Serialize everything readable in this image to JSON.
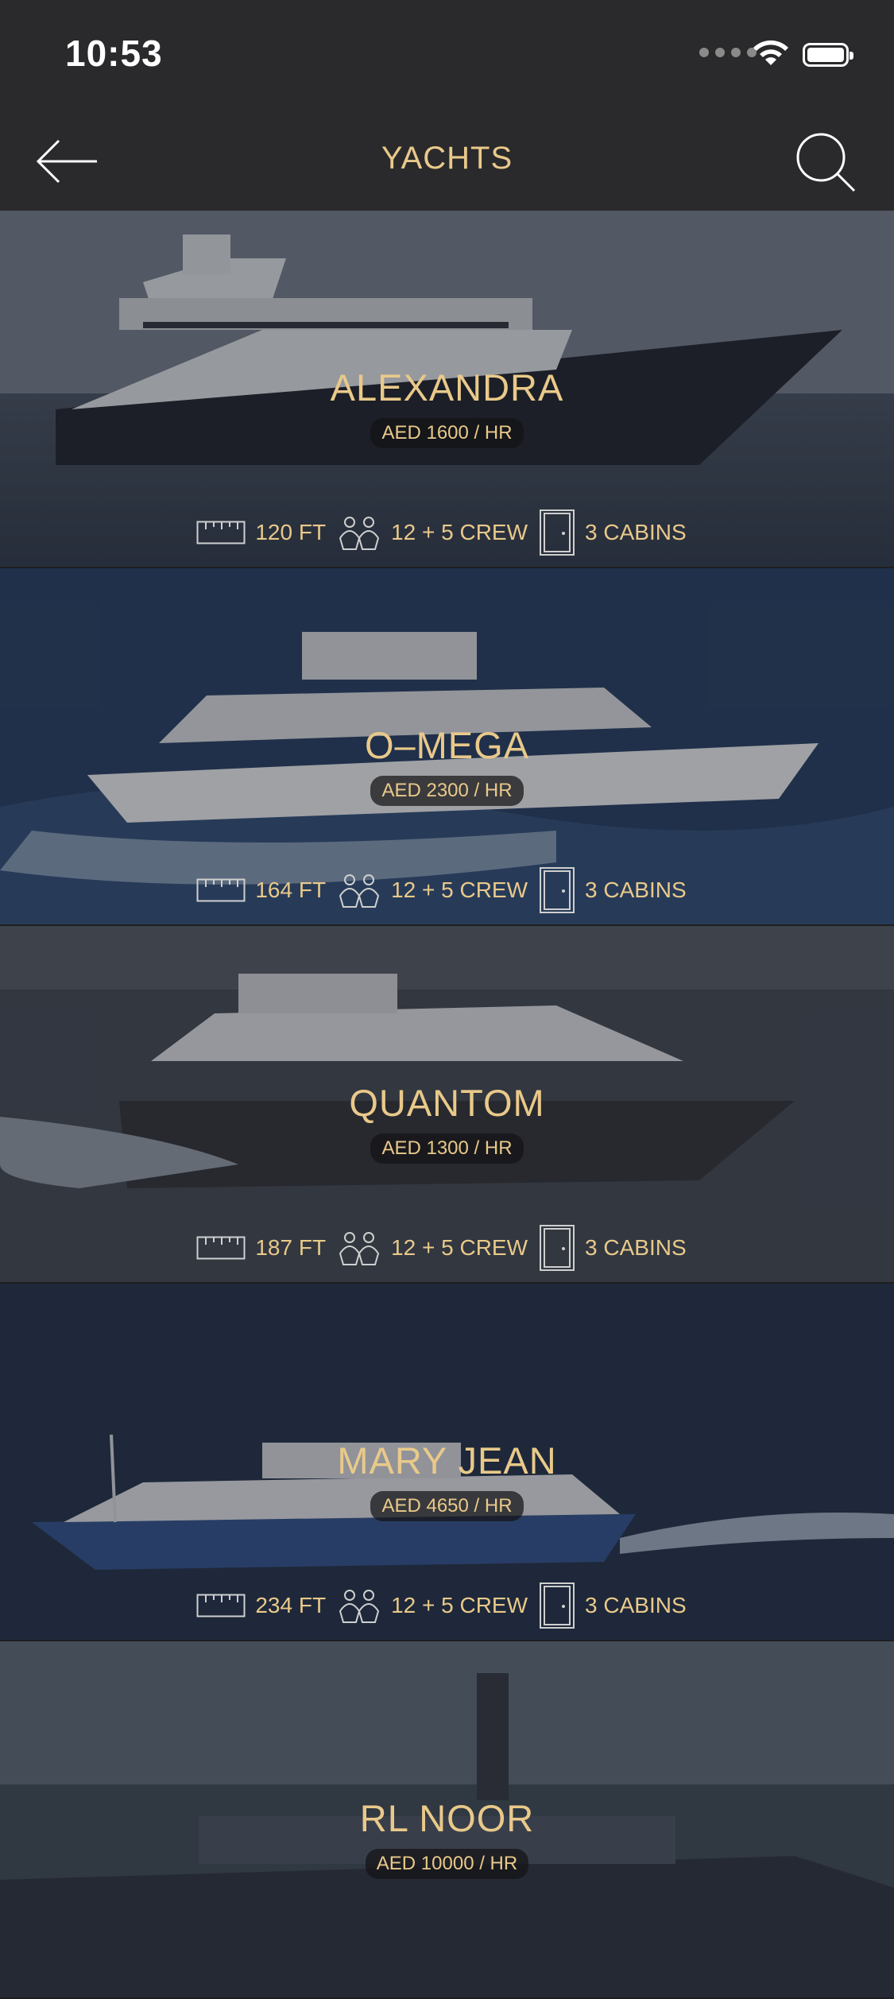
{
  "status": {
    "time": "10:53"
  },
  "nav": {
    "title": "YACHTS"
  },
  "colors": {
    "accent": "#e9c98a",
    "background": "#2a2a2c"
  },
  "yachts": [
    {
      "name": "ALEXANDRA",
      "price": "AED 1600 / HR",
      "length": "120 FT",
      "crew": "12 + 5 CREW",
      "cabins": "3 CABINS"
    },
    {
      "name": "O–MEGA",
      "price": "AED 2300 / HR",
      "length": "164 FT",
      "crew": "12 + 5 CREW",
      "cabins": "3 CABINS"
    },
    {
      "name": "QUANTOM",
      "price": "AED 1300 / HR",
      "length": "187 FT",
      "crew": "12 + 5 CREW",
      "cabins": "3 CABINS"
    },
    {
      "name": "MARY JEAN",
      "price": "AED 4650 / HR",
      "length": "234 FT",
      "crew": "12 + 5 CREW",
      "cabins": "3 CABINS"
    },
    {
      "name": "RL NOOR",
      "price": "AED 10000 / HR",
      "length": "",
      "crew": "",
      "cabins": ""
    }
  ],
  "icons": {
    "back": "arrow-left-icon",
    "search": "search-icon",
    "length": "ruler-icon",
    "crew": "people-icon",
    "cabins": "door-icon"
  }
}
